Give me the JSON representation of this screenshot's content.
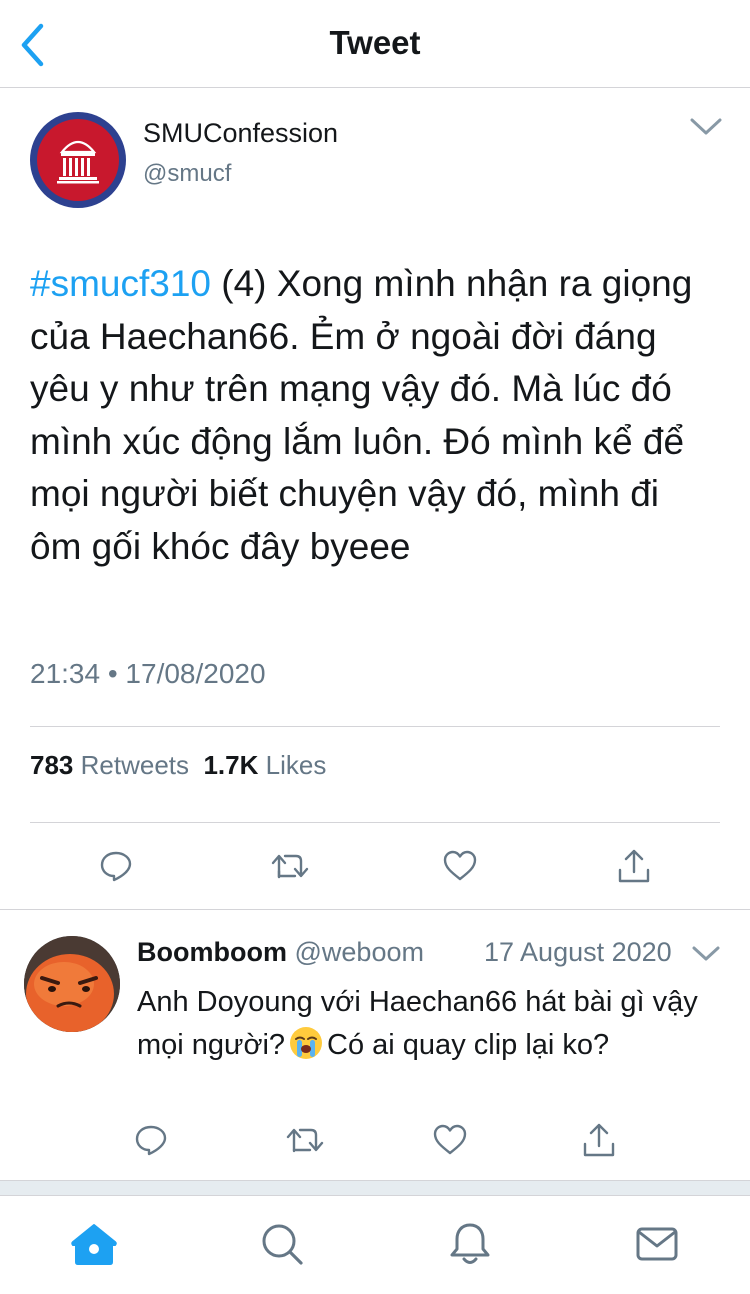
{
  "header": {
    "back_icon": "chevron-left-icon",
    "title": "Tweet"
  },
  "main_tweet": {
    "author": {
      "display_name": "SMUConfession",
      "handle": "@smucf"
    },
    "text": {
      "hashtag": "#smucf310",
      "body": " (4) Xong mình nhận ra giọng của Haechan66. Ẻm ở ngoài đời đáng yêu y như trên mạng vậy đó. Mà lúc đó mình xúc động lắm luôn. Đó mình kể để mọi người biết chuyện vậy đó, mình đi ôm gối khóc đây byeee"
    },
    "timestamp": "21:34 • 17/08/2020",
    "stats": {
      "retweets_count": "783",
      "retweets_label": "Retweets",
      "likes_count": "1.7K",
      "likes_label": "Likes"
    },
    "actions": [
      "reply-icon",
      "retweet-icon",
      "like-icon",
      "share-icon"
    ]
  },
  "reply_tweet": {
    "display_name": "Boomboom",
    "handle": "@weboom",
    "date": "17 August 2020",
    "text_before_emoji": "Anh Doyoung với Haechan66 hát bài gì vậy mọi người?",
    "emoji": "loudly-crying-face-emoji",
    "text_after_emoji": "Có ai quay clip lại ko?",
    "actions": [
      "reply-icon",
      "retweet-icon",
      "like-icon",
      "share-icon"
    ]
  },
  "tab_bar": {
    "tabs": [
      "home-icon",
      "search-icon",
      "notifications-icon",
      "messages-icon"
    ],
    "active": "home-icon"
  },
  "colors": {
    "accent": "#1da1f2",
    "text_primary": "#14171a",
    "text_secondary": "#657786",
    "divider": "#d4d4d8",
    "logo_ring": "#2d4190",
    "logo_fill": "#c8182d"
  }
}
